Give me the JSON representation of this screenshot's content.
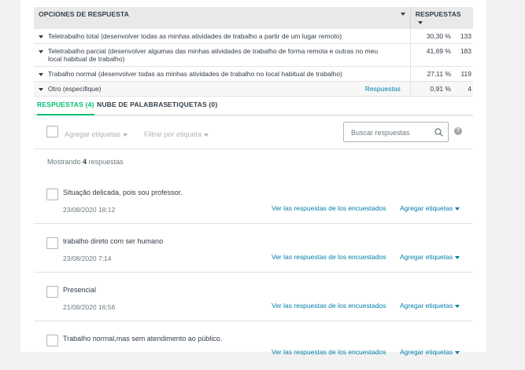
{
  "table": {
    "col_options": "OPCIONES DE RESPUESTA",
    "col_responses": "RESPUESTAS",
    "rows": [
      {
        "label": "Teletrabalho total (desenvolver todas as minhas atividades de trabalho a partir de um lugar remoto)",
        "pct": "30,30 %",
        "count": "133"
      },
      {
        "label": "Teletrabalho parcial (desenvolver algumas das minhas atividades de trabalho de forma remota e outras no meu local habitual de trabalho)",
        "pct": "41,69 %",
        "count": "183"
      },
      {
        "label": "Trabalho normal (desenvolver todas as minhas atividades de trabalho no local habitual de trabalho)",
        "pct": "27,11 %",
        "count": "119"
      }
    ],
    "other": {
      "label": "Otro (especifique)",
      "link": "Respuestas",
      "pct": "0,91 %",
      "count": "4"
    }
  },
  "tabs": {
    "responses": "RESPUESTAS (4)",
    "word_cloud": "NUBE DE PALABRAS",
    "tags": "ETIQUETAS (0)"
  },
  "toolbar": {
    "add_tags": "Agregar etiquetas",
    "filter_by_tag": "Filtrar por etiqueta",
    "search_placeholder": "Buscar respuestas",
    "help": "?"
  },
  "showing": {
    "prefix": "Mostrando",
    "count": "4",
    "suffix": "respuestas"
  },
  "responses": [
    {
      "text": "Situação delicada, pois sou professor.",
      "date": "23/08/2020 18:12",
      "view": "Ver las respuestas de los encuestados",
      "tag": "Agregar etiquetas"
    },
    {
      "text": "trabalho direto com ser humano",
      "date": "23/08/2020 7:14",
      "view": "Ver las respuestas de los encuestados",
      "tag": "Agregar etiquetas"
    },
    {
      "text": "Presencial",
      "date": "21/08/2020 16:56",
      "view": "Ver las respuestas de los encuestados",
      "tag": "Agregar etiquetas"
    },
    {
      "text": "Trabalho normal,mas sem atendimento ao público.",
      "date": "",
      "view": "Ver las respuestas de los encuestados",
      "tag": "Agregar etiquetas"
    }
  ],
  "colors": {
    "accent": "#00bf6f",
    "link": "#007faa",
    "text": "#333e48",
    "muted": "#6b787f"
  }
}
